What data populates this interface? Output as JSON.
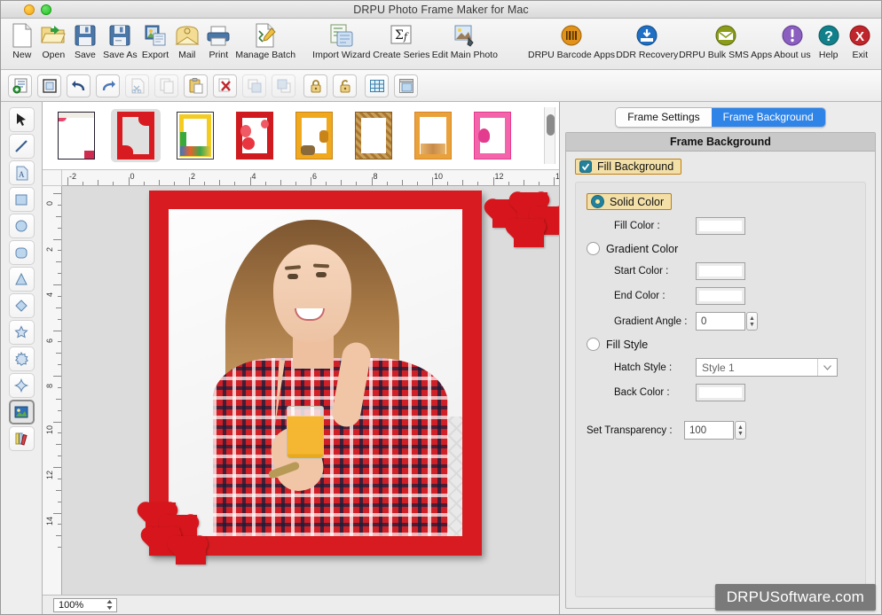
{
  "window": {
    "title": "DRPU Photo Frame Maker for Mac",
    "buttons": [
      {
        "name": "minimize",
        "color": "#f5a623"
      },
      {
        "name": "zoom",
        "color": "#23c123"
      }
    ]
  },
  "toolbar": {
    "items": [
      {
        "label": "New",
        "icon": "new-document-icon"
      },
      {
        "label": "Open",
        "icon": "open-folder-icon"
      },
      {
        "label": "Save",
        "icon": "save-floppy-icon"
      },
      {
        "label": "Save As",
        "icon": "save-as-floppy-icon"
      },
      {
        "label": "Export",
        "icon": "export-icon"
      },
      {
        "label": "Mail",
        "icon": "mail-envelope-icon"
      },
      {
        "label": "Print",
        "icon": "printer-icon"
      },
      {
        "label": "Manage Batch",
        "icon": "manage-batch-icon"
      },
      {
        "label": "Import Wizard",
        "icon": "import-wizard-icon"
      },
      {
        "label": "Create Series",
        "icon": "sigma-function-icon"
      },
      {
        "label": "Edit Main Photo",
        "icon": "edit-photo-icon"
      }
    ],
    "promo_items": [
      {
        "label": "DRPU Barcode Apps",
        "icon": "barcode-icon",
        "color": "#e2921a"
      },
      {
        "label": "DDR Recovery",
        "icon": "recovery-icon",
        "color": "#1f6fc4"
      },
      {
        "label": "DRPU Bulk SMS Apps",
        "icon": "sms-envelope-icon",
        "color": "#8a9c19"
      },
      {
        "label": "About us",
        "icon": "info-icon",
        "color": "#8a5fc0"
      },
      {
        "label": "Help",
        "icon": "question-icon",
        "color": "#12808a"
      },
      {
        "label": "Exit",
        "icon": "close-x-icon",
        "color": "#c0252b"
      }
    ]
  },
  "toolbar2": {
    "items": [
      {
        "name": "add-object-icon",
        "enabled": true
      },
      {
        "name": "select-frame-icon",
        "enabled": true
      },
      {
        "name": "undo-icon",
        "enabled": true
      },
      {
        "name": "redo-icon",
        "enabled": true
      },
      {
        "name": "cut-scissors-icon",
        "enabled": false
      },
      {
        "name": "copy-icon",
        "enabled": false
      },
      {
        "name": "paste-clipboard-icon",
        "enabled": true
      },
      {
        "name": "delete-x-icon",
        "enabled": true
      },
      {
        "name": "bring-to-front-icon",
        "enabled": false
      },
      {
        "name": "send-to-back-icon",
        "enabled": false
      },
      {
        "name": "lock-icon",
        "enabled": true
      },
      {
        "name": "unlock-icon",
        "enabled": true
      },
      {
        "name": "grid-icon",
        "enabled": true
      },
      {
        "name": "page-setup-icon",
        "enabled": true
      }
    ]
  },
  "tool_rail": {
    "items": [
      {
        "name": "pointer-tool",
        "selected": false
      },
      {
        "name": "line-tool",
        "selected": false
      },
      {
        "name": "text-tool",
        "selected": false
      },
      {
        "name": "rectangle-tool",
        "selected": false
      },
      {
        "name": "ellipse-tool",
        "selected": false
      },
      {
        "name": "rounded-rectangle-tool",
        "selected": false
      },
      {
        "name": "triangle-tool",
        "selected": false
      },
      {
        "name": "diamond-tool",
        "selected": false
      },
      {
        "name": "star-tool",
        "selected": false
      },
      {
        "name": "burst-tool",
        "selected": false
      },
      {
        "name": "four-point-star-tool",
        "selected": false
      },
      {
        "name": "image-tool",
        "selected": true
      },
      {
        "name": "library-tool",
        "selected": false
      }
    ]
  },
  "thumbnails": {
    "items": [
      {
        "name": "frame-thumb-1",
        "border": "#241c2e",
        "accent": "#e8456a",
        "selected": false
      },
      {
        "name": "frame-thumb-2",
        "border": "#d81b20",
        "accent": "#d81b20",
        "selected": true
      },
      {
        "name": "frame-thumb-3",
        "border": "#f3cc1f",
        "accent": "#38a93f",
        "selected": false
      },
      {
        "name": "frame-thumb-4",
        "border": "#cf1b20",
        "accent": "#ef5a64",
        "selected": false
      },
      {
        "name": "frame-thumb-5",
        "border": "#f0a81c",
        "accent": "#c98419",
        "selected": false
      },
      {
        "name": "frame-thumb-6",
        "border": "#a9752e",
        "accent": "#c9a05a",
        "selected": false
      },
      {
        "name": "frame-thumb-7",
        "border": "#e9a13a",
        "accent": "#d9852a",
        "selected": false
      },
      {
        "name": "frame-thumb-8",
        "border": "#f364aa",
        "accent": "#e33b8d",
        "selected": false
      }
    ]
  },
  "rulers": {
    "horizontal_labels": [
      "-2",
      "0",
      "2",
      "4",
      "6",
      "8",
      "10",
      "12",
      "14",
      "1"
    ],
    "vertical_labels": [
      "0",
      "2",
      "4",
      "6",
      "8",
      "10",
      "12",
      "14"
    ],
    "unit": "in"
  },
  "canvas": {
    "zoom": "100%",
    "frame_color": "#d81b20",
    "photo_description": "smiling-woman-holding-juice-glass"
  },
  "right_panel": {
    "tabs": [
      {
        "label": "Frame Settings",
        "active": false
      },
      {
        "label": "Frame Background",
        "active": true
      }
    ],
    "heading": "Frame Background",
    "fill_background": {
      "label": "Fill Background",
      "checked": true
    },
    "solid_color": {
      "label": "Solid Color",
      "selected": true,
      "fill_color_label": "Fill Color :",
      "fill_color_value": "#ffffff"
    },
    "gradient_color": {
      "label": "Gradient Color",
      "selected": false,
      "start_color_label": "Start Color :",
      "start_color_value": "#ffffff",
      "end_color_label": "End Color :",
      "end_color_value": "#ffffff",
      "gradient_angle_label": "Gradient Angle :",
      "gradient_angle_value": "0"
    },
    "fill_style": {
      "label": "Fill Style",
      "selected": false,
      "hatch_style_label": "Hatch Style :",
      "hatch_style_value": "Style 1",
      "back_color_label": "Back Color :",
      "back_color_value": "#ffffff"
    },
    "transparency": {
      "label": "Set Transparency :",
      "value": "100"
    }
  },
  "watermark": {
    "text": "DRPUSoftware.com"
  }
}
